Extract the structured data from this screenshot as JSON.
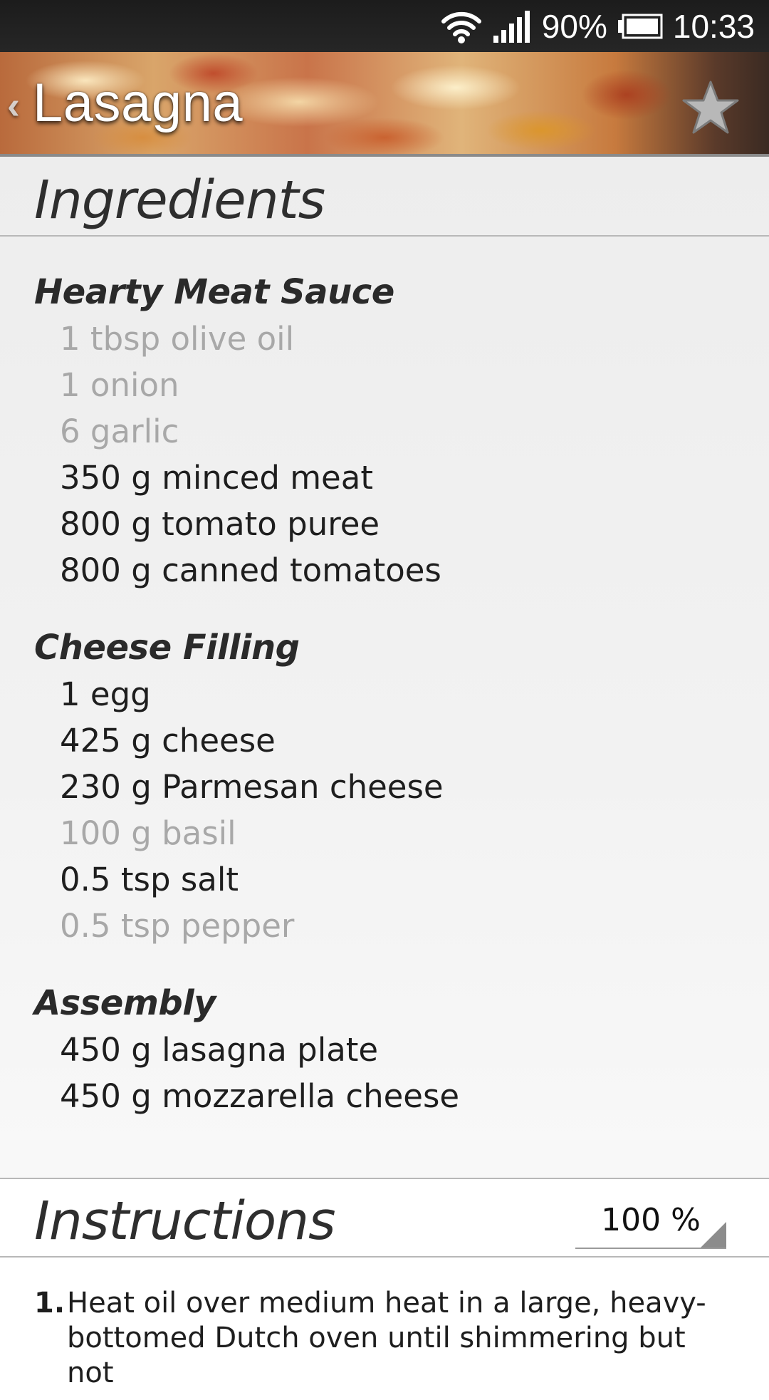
{
  "status_bar": {
    "battery_percent": "90%",
    "time": "10:33",
    "icons": [
      "wifi-icon",
      "signal-icon",
      "battery-icon"
    ]
  },
  "header": {
    "back_glyph": "‹",
    "title": "Lasagna",
    "favorite_icon": "star-icon",
    "favorite_state": "off"
  },
  "ingredients": {
    "title": "Ingredients",
    "groups": [
      {
        "title": "Hearty Meat Sauce",
        "items": [
          {
            "text": "1 tbsp olive oil",
            "available": false
          },
          {
            "text": "1 onion",
            "available": false
          },
          {
            "text": "6 garlic",
            "available": false
          },
          {
            "text": "350 g minced meat",
            "available": true
          },
          {
            "text": "800 g tomato puree",
            "available": true
          },
          {
            "text": "800 g canned tomatoes",
            "available": true
          }
        ]
      },
      {
        "title": "Cheese Filling",
        "items": [
          {
            "text": "1 egg",
            "available": true
          },
          {
            "text": "425 g cheese",
            "available": true
          },
          {
            "text": "230 g Parmesan cheese",
            "available": true
          },
          {
            "text": "100 g basil",
            "available": false
          },
          {
            "text": "0.5 tsp salt",
            "available": true
          },
          {
            "text": "0.5 tsp pepper",
            "available": false
          }
        ]
      },
      {
        "title": "Assembly",
        "items": [
          {
            "text": "450 g lasagna plate",
            "available": true
          },
          {
            "text": "450 g mozzarella cheese",
            "available": true
          }
        ]
      }
    ]
  },
  "instructions": {
    "title": "Instructions",
    "scale_value": "100 %",
    "steps": [
      {
        "num": "1.",
        "text": "Heat oil over medium heat in a large, heavy-bottomed Dutch oven until shimmering but not"
      }
    ]
  },
  "colors": {
    "text_available": "#1e1e1e",
    "text_unavailable": "#a8a8a8",
    "status_bar_bg": "#1c1c1c"
  }
}
